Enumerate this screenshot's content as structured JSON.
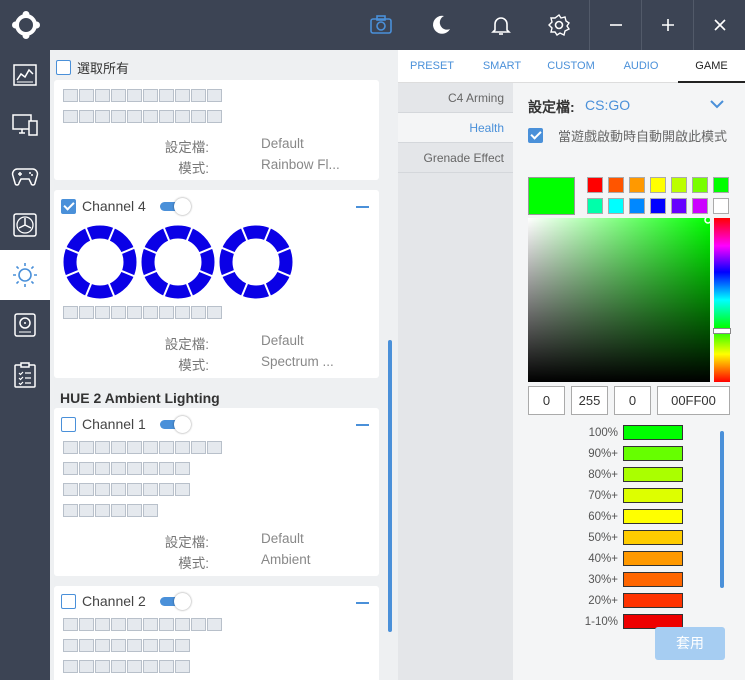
{
  "header": {
    "icons": [
      "logo-icon",
      "camera-icon",
      "moon-icon",
      "bell-icon",
      "gear-icon"
    ],
    "window_controls": [
      "−",
      "+",
      "✕"
    ]
  },
  "sidebar": {
    "items": [
      "dashboard-icon",
      "monitor-icon",
      "gamepad-icon",
      "fan-icon",
      "lighting-icon",
      "storage-icon",
      "clipboard-icon"
    ],
    "active": "lighting-icon"
  },
  "left_panel": {
    "select_all_label": "選取所有",
    "top_card": {
      "profile_key": "設定檔:",
      "profile_value": "Default",
      "mode_key": "模式:",
      "mode_value": "Rainbow Fl..."
    },
    "channel4": {
      "label": "Channel 4",
      "checked": true,
      "profile_key": "設定檔:",
      "profile_value": "Default",
      "mode_key": "模式:",
      "mode_value": "Spectrum ..."
    },
    "section_title": "HUE 2 Ambient Lighting",
    "ambient_channel1": {
      "label": "Channel 1",
      "checked": false,
      "profile_key": "設定檔:",
      "profile_value": "Default",
      "mode_key": "模式:",
      "mode_value": "Ambient"
    },
    "ambient_channel2": {
      "label": "Channel 2",
      "checked": false
    },
    "ring_color": "#0a00e6"
  },
  "right_panel": {
    "tabs": [
      "PRESET",
      "SMART",
      "CUSTOM",
      "AUDIO",
      "GAME"
    ],
    "active_tab": "GAME",
    "game_events": [
      "C4 Arming",
      "Health",
      "Grenade Effect"
    ],
    "active_event": "Health",
    "profile_label": "設定檔:",
    "profile_value": "CS:GO",
    "auto_enable_text": "當遊戲啟動時自動開啟此模式",
    "auto_enable_checked": true,
    "selected_color": "#00ff00",
    "swatches": [
      "#ff0000",
      "#ff5500",
      "#ff9900",
      "#ffff00",
      "#bbff00",
      "#77ff00",
      "#00ff00",
      "#00ffaa",
      "#00ffff",
      "#0088ff",
      "#0000ff",
      "#6600ff",
      "#cc00ff",
      "#ffffff"
    ],
    "rgb_r": "0",
    "rgb_g": "255",
    "rgb_b": "0",
    "hex": "00FF00",
    "levels": [
      {
        "label": "100%",
        "color": "#00ff00"
      },
      {
        "label": "90%+",
        "color": "#66ff00"
      },
      {
        "label": "80%+",
        "color": "#aaff00"
      },
      {
        "label": "70%+",
        "color": "#ddff00"
      },
      {
        "label": "60%+",
        "color": "#ffff00"
      },
      {
        "label": "50%+",
        "color": "#ffcc00"
      },
      {
        "label": "40%+",
        "color": "#ff9900"
      },
      {
        "label": "30%+",
        "color": "#ff6600"
      },
      {
        "label": "20%+",
        "color": "#ff3300"
      },
      {
        "label": "1-10%",
        "color": "#ee0000"
      }
    ],
    "apply_label": "套用"
  }
}
